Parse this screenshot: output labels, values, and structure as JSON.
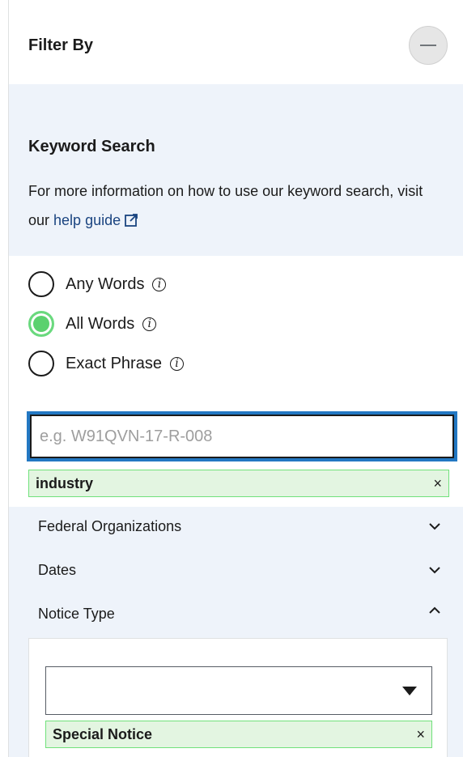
{
  "filter": {
    "title": "Filter By"
  },
  "keyword": {
    "title": "Keyword Search",
    "help_text": "For more information on how to use our keyword search, visit our ",
    "help_link": "help guide",
    "options": [
      {
        "label": "Any Words",
        "checked": false
      },
      {
        "label": "All Words",
        "checked": true
      },
      {
        "label": "Exact Phrase",
        "checked": false
      }
    ],
    "input_value": "",
    "input_placeholder": "e.g. W91QVN-17-R-008",
    "chip_label": "industry",
    "chip_remove": "×"
  },
  "accordions": [
    {
      "label": "Federal Organizations",
      "expanded": false
    },
    {
      "label": "Dates",
      "expanded": false
    },
    {
      "label": "Notice Type",
      "expanded": true
    }
  ],
  "notice_type": {
    "selected_value": "",
    "chip_label": "Special Notice",
    "chip_remove": "×"
  },
  "colors": {
    "accent": "#2378c3",
    "panel_bg": "#eef3fa",
    "chip_bg": "#e3f5e1",
    "radio_checked": "#5bd16e",
    "link": "#1a4480"
  }
}
